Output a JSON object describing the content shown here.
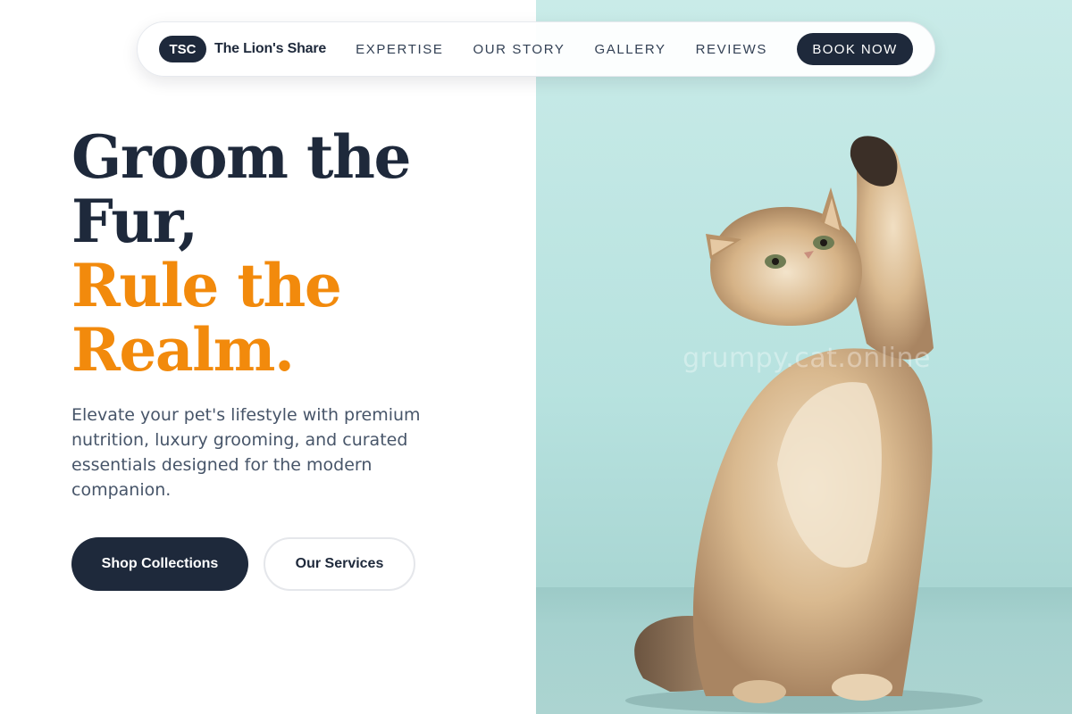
{
  "brand": {
    "badge": "TSC",
    "name": "The Lion's Share"
  },
  "nav": {
    "links": [
      "EXPERTISE",
      "OUR STORY",
      "GALLERY",
      "REVIEWS"
    ],
    "cta": "BOOK NOW"
  },
  "hero": {
    "headline_dark_1": "Groom the",
    "headline_dark_2": "Fur,",
    "headline_accent_1": "Rule the",
    "headline_accent_2": "Realm.",
    "subtext": "Elevate your pet's lifestyle with premium nutrition, luxury grooming, and curated essentials designed for the modern companion.",
    "primary_cta": "Shop Collections",
    "secondary_cta": "Our Services"
  },
  "image": {
    "subject": "kitten raising paw",
    "watermark": "grumpy.cat.online"
  },
  "colors": {
    "navy": "#1e293b",
    "accent_orange": "#f28a0c",
    "photo_background": "#c3e7e4"
  }
}
